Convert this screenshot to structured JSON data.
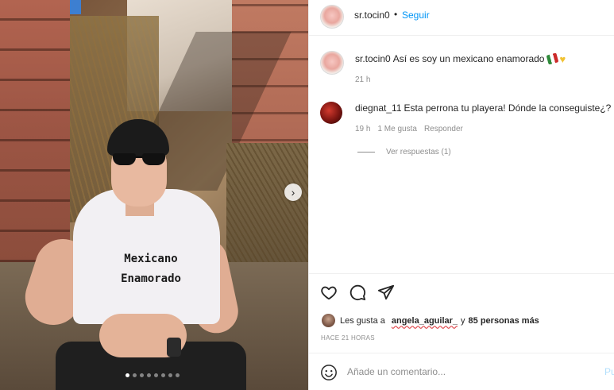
{
  "post": {
    "image_dots": 8,
    "image_active_dot": 0
  },
  "shirt": {
    "line1": "Mexicano",
    "line2": "Enamorado"
  },
  "header": {
    "username": "sr.tocin0",
    "separator": "•",
    "follow_label": "Seguir"
  },
  "caption": {
    "username": "sr.tocin0",
    "text": "Así es soy un mexicano enamorado",
    "emojis": [
      "mexico-flag-icon",
      "yellow-heart-icon"
    ],
    "time": "21 h"
  },
  "comments": [
    {
      "username": "diegnat_11",
      "text": "Esta perrona tu playera! Dónde la conseguiste¿?",
      "time": "19 h",
      "likes": "1 Me gusta",
      "reply_label": "Responder",
      "view_replies": "Ver respuestas (1)"
    }
  ],
  "actions": {
    "icons": [
      "heart-icon",
      "comment-icon",
      "share-icon"
    ]
  },
  "likes": {
    "prefix": "Les gusta a",
    "liker": "angela_aguilar_",
    "connector": "y",
    "others": "85 personas más"
  },
  "posted_ago": "HACE 21 HORAS",
  "add_comment": {
    "placeholder": "Añade un comentario...",
    "publish_label": "Pu"
  },
  "colors": {
    "link_blue": "#0095f6",
    "muted_text": "#8e8e8e",
    "primary_text": "#262626",
    "publish_disabled": "#b2dffc"
  }
}
